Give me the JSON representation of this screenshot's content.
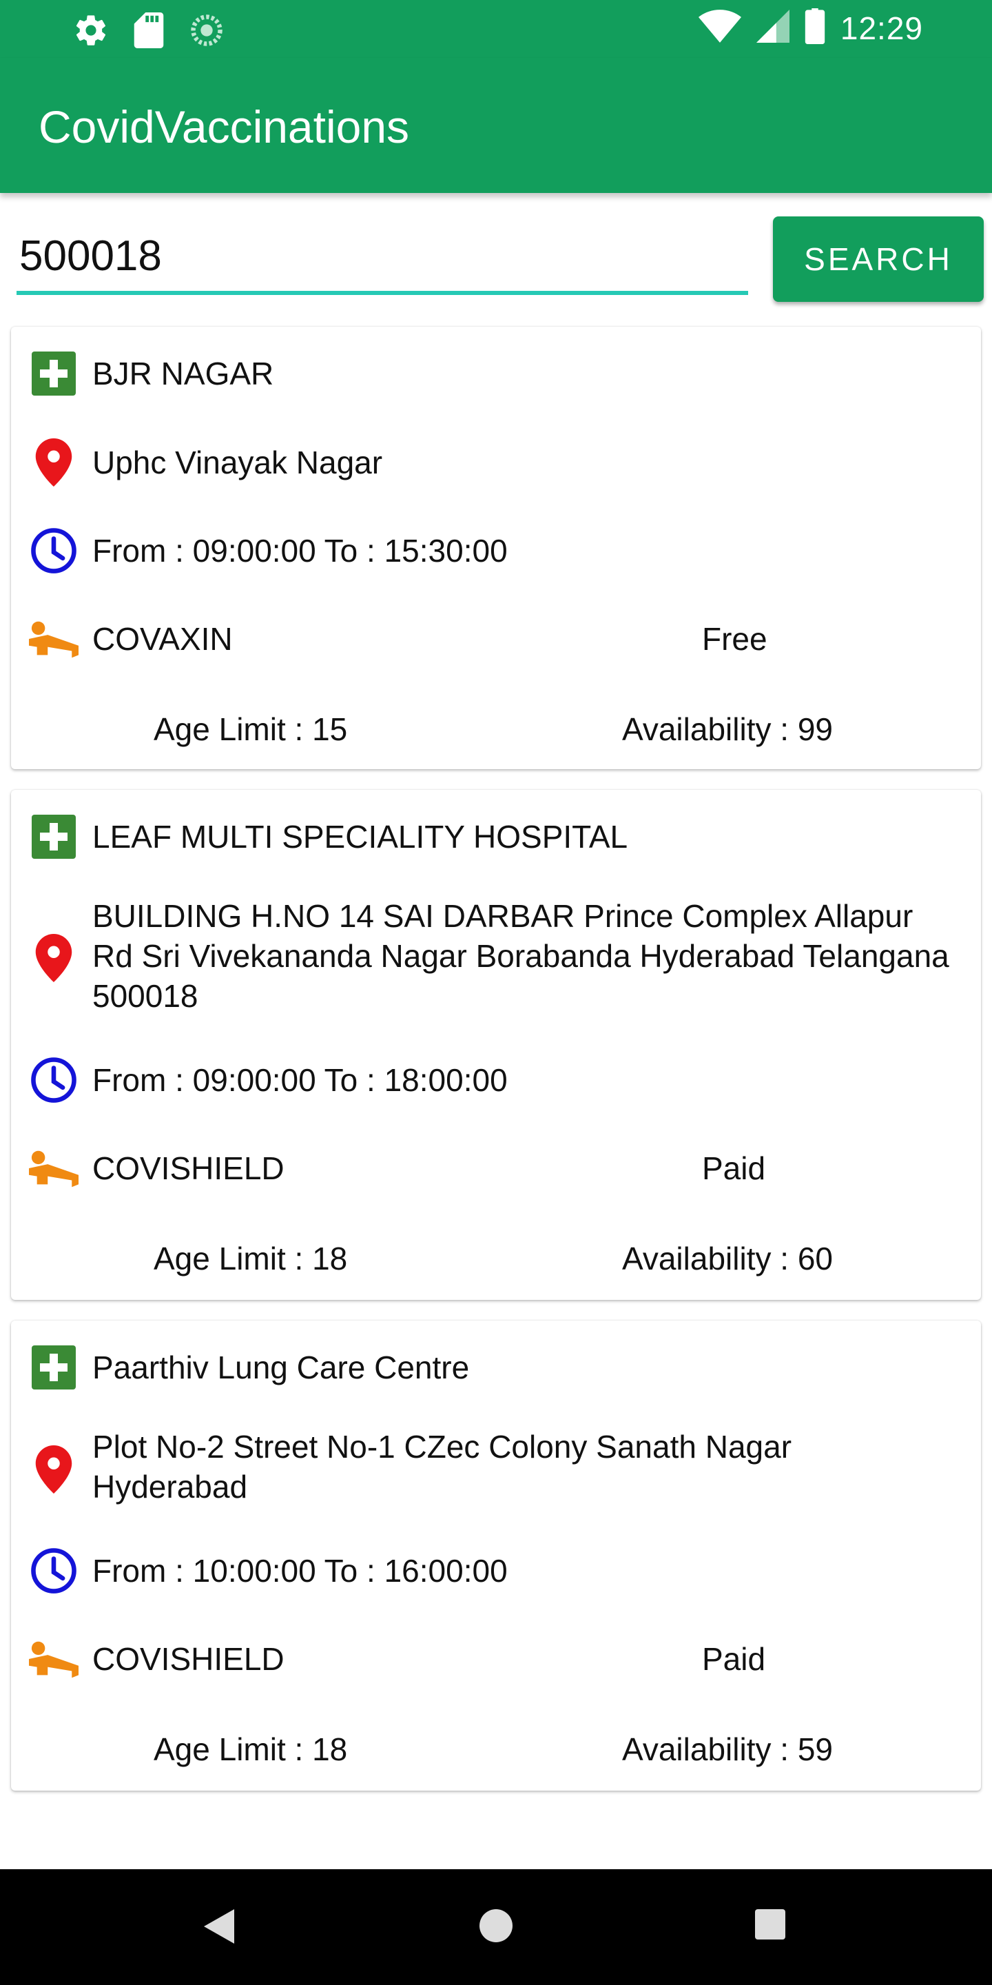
{
  "status_bar": {
    "time": "12:29",
    "icons": [
      "settings-icon",
      "sd-card-icon",
      "sync-icon",
      "wifi-icon",
      "signal-icon",
      "battery-icon"
    ]
  },
  "app": {
    "title": "CovidVaccinations",
    "brand_color": "#129e5c",
    "accent_color": "#26c9b5"
  },
  "search": {
    "value": "500018",
    "button_label": "SEARCH"
  },
  "centers": [
    {
      "name": "BJR NAGAR",
      "address": "Uphc Vinayak Nagar",
      "time": "From : 09:00:00 To : 15:30:00",
      "vaccine": "COVAXIN",
      "fee": "Free",
      "age_limit": "Age Limit : 15",
      "availability": "Availability : 99"
    },
    {
      "name": "LEAF MULTI SPECIALITY HOSPITAL",
      "address": "BUILDING H.NO 14 SAI DARBAR Prince Complex Allapur Rd Sri Vivekananda Nagar Borabanda Hyderabad Telangana 500018",
      "time": "From : 09:00:00 To : 18:00:00",
      "vaccine": "COVISHIELD",
      "fee": "Paid",
      "age_limit": "Age Limit : 18",
      "availability": "Availability : 60"
    },
    {
      "name": "Paarthiv Lung Care Centre",
      "address": "Plot No-2 Street No-1 CZec Colony Sanath Nagar Hyderabad",
      "time": "From : 10:00:00 To : 16:00:00",
      "vaccine": "COVISHIELD",
      "fee": "Paid",
      "age_limit": "Age Limit : 18",
      "availability": "Availability : 59"
    }
  ],
  "nav_bar": {
    "buttons": [
      "back-icon",
      "home-icon",
      "recents-icon"
    ]
  }
}
